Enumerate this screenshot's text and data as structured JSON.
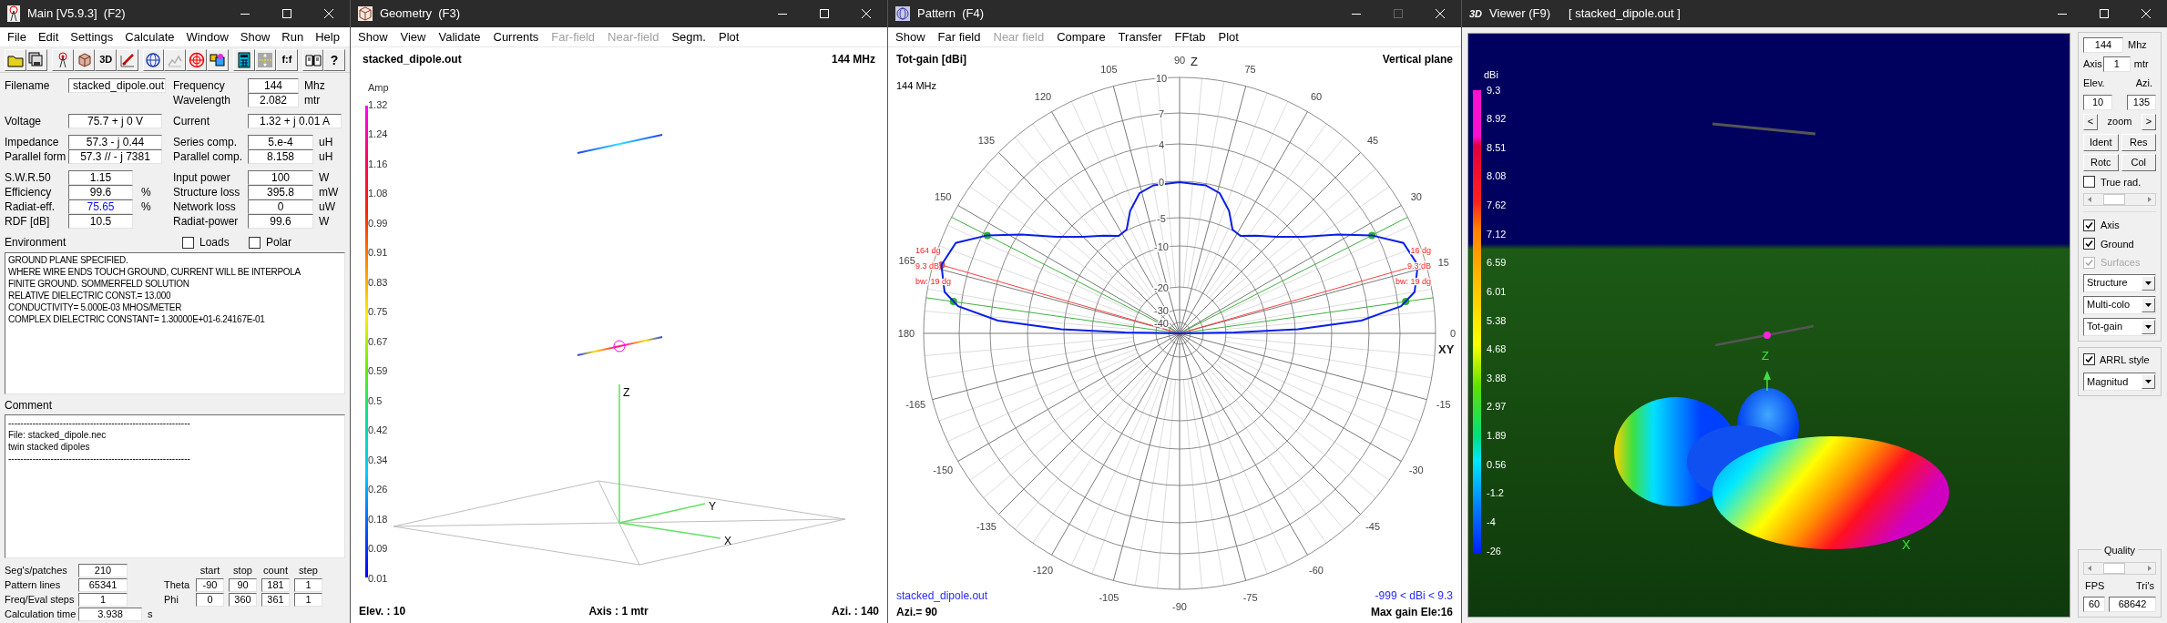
{
  "main": {
    "title": "Main [V5.9.3]  (F2)",
    "maximize_enabled": true,
    "menu": [
      "File",
      "Edit",
      "Settings",
      "Calculate",
      "Window",
      "Show",
      "Run",
      "Help"
    ],
    "toolbar": [
      {
        "kind": "folder"
      },
      {
        "kind": "disks"
      },
      {
        "kind": "antenna"
      },
      {
        "kind": "cube"
      },
      {
        "kind": "label",
        "text": "3D"
      },
      {
        "kind": "pencil"
      },
      {
        "kind": "globe"
      },
      {
        "kind": "chart"
      },
      {
        "kind": "sphere"
      },
      {
        "kind": "palette"
      },
      {
        "kind": "calculator"
      },
      {
        "kind": "arrows"
      },
      {
        "kind": "label",
        "text": "f:f"
      },
      {
        "kind": "book"
      },
      {
        "kind": "help",
        "text": "?"
      }
    ],
    "groups": [
      [
        {
          "left": {
            "label": "Filename",
            "value": "stacked_dipole.out",
            "highlighted": false
          },
          "right": {
            "label": "Frequency",
            "value": "144",
            "unit": "Mhz",
            "highlighted": false
          }
        },
        {
          "right": {
            "label": "Wavelength",
            "value": "2.082",
            "unit": "mtr",
            "highlighted": false
          }
        }
      ],
      [
        {
          "left": {
            "label": "Voltage",
            "value": "75.7 + j 0 V",
            "highlighted": false
          },
          "right": {
            "label": "Current",
            "value": "1.32 + j 0.01 A",
            "highlighted": false
          }
        }
      ],
      [
        {
          "left": {
            "label": "Impedance",
            "value": "57.3 - j 0.44",
            "highlighted": false
          },
          "right": {
            "label": "Series comp.",
            "value": "5.e-4",
            "unit": "uH",
            "highlighted": false
          }
        },
        {
          "left": {
            "label": "Parallel form",
            "value": "57.3 // - j 7381",
            "highlighted": false
          },
          "right": {
            "label": "Parallel comp.",
            "value": "8.158",
            "unit": "uH",
            "highlighted": false
          }
        }
      ],
      [
        {
          "left": {
            "label": "S.W.R.50",
            "value": "1.15",
            "highlighted": false
          },
          "right": {
            "label": "Input power",
            "value": "100",
            "unit": "W",
            "highlighted": false
          }
        },
        {
          "left": {
            "label": "Efficiency",
            "value": "99.6",
            "unit": "%",
            "highlighted": false
          },
          "right": {
            "label": "Structure loss",
            "value": "395.8",
            "unit": "mW",
            "highlighted": false
          }
        },
        {
          "left": {
            "label": "Radiat-eff.",
            "value": "75.65",
            "unit": "%",
            "highlighted": true
          },
          "right": {
            "label": "Network loss",
            "value": "0",
            "unit": "uW",
            "highlighted": false
          }
        },
        {
          "left": {
            "label": "RDF [dB]",
            "value": "10.5",
            "highlighted": false
          },
          "right": {
            "label": "Radiat-power",
            "value": "99.6",
            "unit": "W",
            "highlighted": false
          }
        }
      ]
    ],
    "environment": {
      "label": "Environment",
      "options": [
        {
          "label": "Loads",
          "checked": false
        },
        {
          "label": "Polar",
          "checked": false
        }
      ],
      "lines": [
        "GROUND PLANE SPECIFIED.",
        "WHERE WIRE ENDS TOUCH GROUND, CURRENT WILL BE INTERPOLA",
        "FINITE GROUND.  SOMMERFELD SOLUTION",
        "RELATIVE DIELECTRIC CONST.= 13.000",
        "CONDUCTIVITY= 5.000E-03 MHOS/METER",
        "COMPLEX DIELECTRIC CONSTANT= 1.30000E+01-6.24167E-01"
      ]
    },
    "comment": {
      "label": "Comment",
      "lines": [
        "------------------------------------------------------------",
        "File: stacked_dipole.nec",
        "twin stacked dipoles",
        "------------------------------------------------------------"
      ]
    },
    "stats": [
      {
        "label": "Seg's/patches",
        "value": "210"
      },
      {
        "label": "Pattern lines",
        "value": "65341"
      },
      {
        "label": "Freq/Eval steps",
        "value": "1"
      },
      {
        "label": "Calculation time",
        "value": "3.938",
        "unit": "s"
      }
    ],
    "sweep": {
      "headers": [
        "start",
        "stop",
        "count",
        "step"
      ],
      "rows": [
        {
          "label": "Theta",
          "values": [
            "-90",
            "90",
            "181",
            "1"
          ]
        },
        {
          "label": "Phi",
          "values": [
            "0",
            "360",
            "361",
            "1"
          ]
        }
      ]
    }
  },
  "geometry": {
    "title": "Geometry  (F3)",
    "maximize_enabled": true,
    "menu": [
      {
        "label": "Show",
        "disabled": false
      },
      {
        "label": "View",
        "disabled": false
      },
      {
        "label": "Validate",
        "disabled": false
      },
      {
        "label": "Currents",
        "disabled": false
      },
      {
        "label": "Far-field",
        "disabled": true
      },
      {
        "label": "Near-field",
        "disabled": true
      },
      {
        "label": "Segm.",
        "disabled": false
      },
      {
        "label": "Plot",
        "disabled": false
      }
    ],
    "file": "stacked_dipole.out",
    "frequency": "144 MHz",
    "scale_title": "Amp",
    "scale": [
      "1.32",
      "1.24",
      "1.16",
      "1.08",
      "0.99",
      "0.91",
      "0.83",
      "0.75",
      "0.67",
      "0.59",
      "0.5",
      "0.42",
      "0.34",
      "0.26",
      "0.18",
      "0.09",
      "0.01"
    ],
    "axes": {
      "z": "Z",
      "y": "Y",
      "x": "X"
    },
    "status": [
      "Elev. : 10",
      "Axis : 1 mtr",
      "Azi. : 140"
    ]
  },
  "pattern": {
    "title": "Pattern  (F4)",
    "maximize_enabled": false,
    "menu": [
      {
        "label": "Show",
        "disabled": false
      },
      {
        "label": "Far field",
        "disabled": false
      },
      {
        "label": "Near field",
        "disabled": true
      },
      {
        "label": "Compare",
        "disabled": false
      },
      {
        "label": "Transfer",
        "disabled": false
      },
      {
        "label": "FFtab",
        "disabled": false
      },
      {
        "label": "Plot",
        "disabled": false
      }
    ],
    "quantity": "Tot-gain [dBi]",
    "plane": "Vertical plane",
    "frequency": "144 MHz",
    "rings": [
      "10",
      "7",
      "4",
      "0",
      "-5",
      "-10",
      "-20",
      "-30",
      "-40"
    ],
    "angles": [
      "90",
      "105",
      "120",
      "135",
      "150",
      "165",
      "180",
      "-165",
      "-150",
      "-135",
      "-120",
      "-105",
      "-90",
      "-75",
      "-60",
      "-45",
      "-30",
      "-15",
      "0",
      "15",
      "30",
      "45",
      "60",
      "75"
    ],
    "axes": {
      "z": "Z",
      "xy": "XY"
    },
    "lobes": [
      {
        "angle": "164 dg",
        "gain": "9.3 dB",
        "beamwidth": "bw: 19 dg"
      },
      {
        "angle": "16 dg",
        "gain": "9.3 dB",
        "beamwidth": "bw: 19 dg"
      }
    ],
    "file": "stacked_dipole.out",
    "azimuth": "Azi.= 90",
    "range": "-999 < dBi < 9.3",
    "max_gain": "Max gain Ele:16"
  },
  "viewer": {
    "title": "Viewer (F9)",
    "file": "[ stacked_dipole.out ]",
    "logo": "3D",
    "maximize_enabled": true,
    "scale_title": "dBi",
    "scale": [
      "9.3",
      "8.92",
      "8.51",
      "8.08",
      "7.62",
      "7.12",
      "6.59",
      "6.01",
      "5.38",
      "4.68",
      "3.88",
      "2.97",
      "1.89",
      "0.56",
      "-1.2",
      "-4",
      "-26"
    ],
    "axes": {
      "z": "Z",
      "x": "X"
    },
    "controls": {
      "frequency": {
        "value": "144",
        "unit": "Mhz"
      },
      "axis": {
        "label": "Axis",
        "value": "1",
        "unit": "mtr"
      },
      "elevation": {
        "label": "Elev.",
        "value": "10"
      },
      "azimuth": {
        "label": "Azi.",
        "value": "135"
      },
      "zoom": {
        "label": "zoom",
        "prev": "<",
        "next": ">"
      },
      "buttons": [
        "Ident",
        "Res",
        "Rotc",
        "Col"
      ],
      "true_rad": {
        "label": "True rad.",
        "checked": false
      },
      "slider": {
        "level": 0.3
      },
      "display": [
        {
          "label": "Axis",
          "checked": true,
          "disabled": false
        },
        {
          "label": "Ground",
          "checked": true,
          "disabled": false
        },
        {
          "label": "Surfaces",
          "checked": true,
          "disabled": true
        }
      ],
      "selects": [
        "Structure",
        "Multi-colo",
        "Tot-gain"
      ],
      "arrl": {
        "label": "ARRL style",
        "checked": true
      },
      "arrl_select": "Magnitud",
      "quality": {
        "title": "Quality",
        "level": 0.3,
        "fps_label": "FPS",
        "fps": "60",
        "tris_label": "Tri's",
        "tris": "68642"
      }
    }
  }
}
